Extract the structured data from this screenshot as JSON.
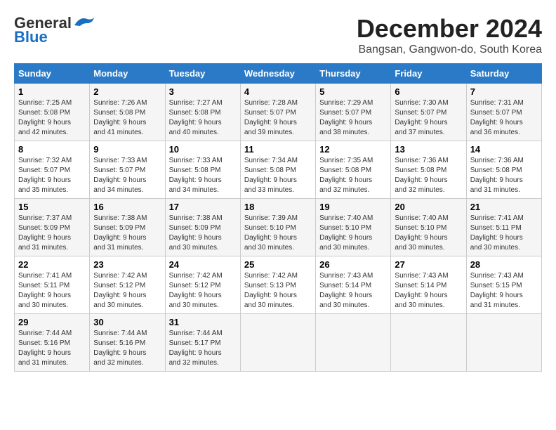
{
  "logo": {
    "line1": "General",
    "line2": "Blue"
  },
  "title": "December 2024",
  "subtitle": "Bangsan, Gangwon-do, South Korea",
  "headers": [
    "Sunday",
    "Monday",
    "Tuesday",
    "Wednesday",
    "Thursday",
    "Friday",
    "Saturday"
  ],
  "weeks": [
    [
      {
        "day": "1",
        "sunrise": "7:25 AM",
        "sunset": "5:08 PM",
        "daylight": "9 hours and 42 minutes."
      },
      {
        "day": "2",
        "sunrise": "7:26 AM",
        "sunset": "5:08 PM",
        "daylight": "9 hours and 41 minutes."
      },
      {
        "day": "3",
        "sunrise": "7:27 AM",
        "sunset": "5:08 PM",
        "daylight": "9 hours and 40 minutes."
      },
      {
        "day": "4",
        "sunrise": "7:28 AM",
        "sunset": "5:07 PM",
        "daylight": "9 hours and 39 minutes."
      },
      {
        "day": "5",
        "sunrise": "7:29 AM",
        "sunset": "5:07 PM",
        "daylight": "9 hours and 38 minutes."
      },
      {
        "day": "6",
        "sunrise": "7:30 AM",
        "sunset": "5:07 PM",
        "daylight": "9 hours and 37 minutes."
      },
      {
        "day": "7",
        "sunrise": "7:31 AM",
        "sunset": "5:07 PM",
        "daylight": "9 hours and 36 minutes."
      }
    ],
    [
      {
        "day": "8",
        "sunrise": "7:32 AM",
        "sunset": "5:07 PM",
        "daylight": "9 hours and 35 minutes."
      },
      {
        "day": "9",
        "sunrise": "7:33 AM",
        "sunset": "5:07 PM",
        "daylight": "9 hours and 34 minutes."
      },
      {
        "day": "10",
        "sunrise": "7:33 AM",
        "sunset": "5:08 PM",
        "daylight": "9 hours and 34 minutes."
      },
      {
        "day": "11",
        "sunrise": "7:34 AM",
        "sunset": "5:08 PM",
        "daylight": "9 hours and 33 minutes."
      },
      {
        "day": "12",
        "sunrise": "7:35 AM",
        "sunset": "5:08 PM",
        "daylight": "9 hours and 32 minutes."
      },
      {
        "day": "13",
        "sunrise": "7:36 AM",
        "sunset": "5:08 PM",
        "daylight": "9 hours and 32 minutes."
      },
      {
        "day": "14",
        "sunrise": "7:36 AM",
        "sunset": "5:08 PM",
        "daylight": "9 hours and 31 minutes."
      }
    ],
    [
      {
        "day": "15",
        "sunrise": "7:37 AM",
        "sunset": "5:09 PM",
        "daylight": "9 hours and 31 minutes."
      },
      {
        "day": "16",
        "sunrise": "7:38 AM",
        "sunset": "5:09 PM",
        "daylight": "9 hours and 31 minutes."
      },
      {
        "day": "17",
        "sunrise": "7:38 AM",
        "sunset": "5:09 PM",
        "daylight": "9 hours and 30 minutes."
      },
      {
        "day": "18",
        "sunrise": "7:39 AM",
        "sunset": "5:10 PM",
        "daylight": "9 hours and 30 minutes."
      },
      {
        "day": "19",
        "sunrise": "7:40 AM",
        "sunset": "5:10 PM",
        "daylight": "9 hours and 30 minutes."
      },
      {
        "day": "20",
        "sunrise": "7:40 AM",
        "sunset": "5:10 PM",
        "daylight": "9 hours and 30 minutes."
      },
      {
        "day": "21",
        "sunrise": "7:41 AM",
        "sunset": "5:11 PM",
        "daylight": "9 hours and 30 minutes."
      }
    ],
    [
      {
        "day": "22",
        "sunrise": "7:41 AM",
        "sunset": "5:11 PM",
        "daylight": "9 hours and 30 minutes."
      },
      {
        "day": "23",
        "sunrise": "7:42 AM",
        "sunset": "5:12 PM",
        "daylight": "9 hours and 30 minutes."
      },
      {
        "day": "24",
        "sunrise": "7:42 AM",
        "sunset": "5:12 PM",
        "daylight": "9 hours and 30 minutes."
      },
      {
        "day": "25",
        "sunrise": "7:42 AM",
        "sunset": "5:13 PM",
        "daylight": "9 hours and 30 minutes."
      },
      {
        "day": "26",
        "sunrise": "7:43 AM",
        "sunset": "5:14 PM",
        "daylight": "9 hours and 30 minutes."
      },
      {
        "day": "27",
        "sunrise": "7:43 AM",
        "sunset": "5:14 PM",
        "daylight": "9 hours and 30 minutes."
      },
      {
        "day": "28",
        "sunrise": "7:43 AM",
        "sunset": "5:15 PM",
        "daylight": "9 hours and 31 minutes."
      }
    ],
    [
      {
        "day": "29",
        "sunrise": "7:44 AM",
        "sunset": "5:16 PM",
        "daylight": "9 hours and 31 minutes."
      },
      {
        "day": "30",
        "sunrise": "7:44 AM",
        "sunset": "5:16 PM",
        "daylight": "9 hours and 32 minutes."
      },
      {
        "day": "31",
        "sunrise": "7:44 AM",
        "sunset": "5:17 PM",
        "daylight": "9 hours and 32 minutes."
      },
      null,
      null,
      null,
      null
    ]
  ]
}
